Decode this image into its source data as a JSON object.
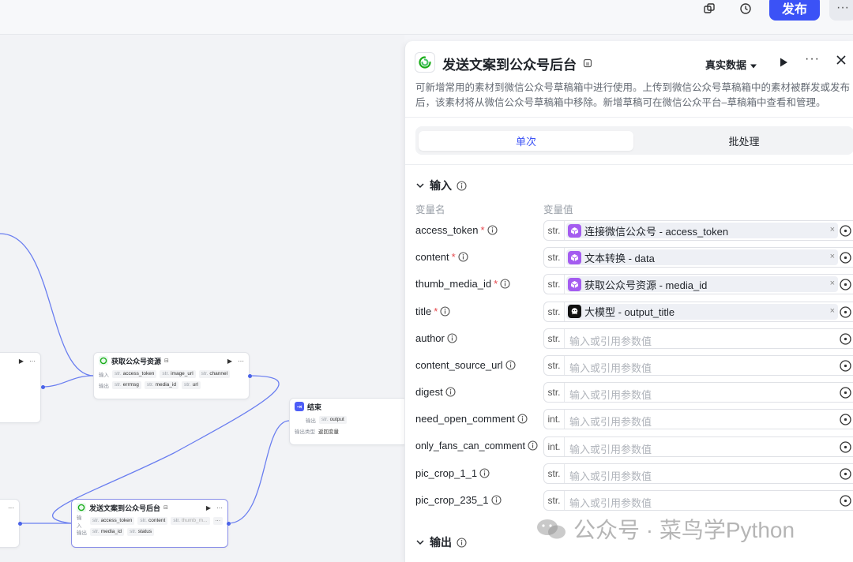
{
  "topbar": {
    "publish_label": "发布",
    "more_label": "···"
  },
  "canvas": {
    "node_fetch": {
      "title": "获取公众号资源",
      "in_label": "输入",
      "out_label": "输出",
      "inputs": [
        {
          "type": "str.",
          "name": "access_token"
        },
        {
          "type": "str.",
          "name": "image_url"
        },
        {
          "type": "str.",
          "name": "channel"
        }
      ],
      "outputs": [
        {
          "type": "str.",
          "name": "errmsg"
        },
        {
          "type": "str.",
          "name": "media_id"
        },
        {
          "type": "str.",
          "name": "url"
        }
      ]
    },
    "node_end": {
      "title": "结束",
      "out_label": "输出",
      "output": {
        "type": "str.",
        "name": "output"
      },
      "out_type_label": "输出类型",
      "out_type_value": "返回变量"
    },
    "node_send": {
      "title": "发送文案到公众号后台",
      "in_label": "输入",
      "out_label": "输出",
      "inputs": [
        {
          "type": "str.",
          "name": "access_token"
        },
        {
          "type": "str.",
          "name": "content"
        },
        {
          "type": "str.",
          "name": "thumb_m..."
        }
      ],
      "more": "···",
      "outputs": [
        {
          "type": "str.",
          "name": "media_id"
        },
        {
          "type": "str.",
          "name": "status"
        }
      ]
    }
  },
  "panel": {
    "title": "发送文案到公众号后台",
    "data_mode": "真实数据",
    "more": "···",
    "description": "可新增常用的素材到微信公众号草稿箱中进行使用。上传到微信公众号草稿箱中的素材被群发或发布后，该素材将从微信公众号草稿箱中移除。新增草稿可在微信公众平台–草稿箱中查看和管理。",
    "tabs": [
      "单次",
      "批处理"
    ],
    "input_section": "输入",
    "output_section": "输出",
    "col_name": "变量名",
    "col_value": "变量值",
    "params": [
      {
        "name": "access_token",
        "required": true,
        "type": "str.",
        "ref_icon": "purple",
        "ref_text": "连接微信公众号 - access_token"
      },
      {
        "name": "content",
        "required": true,
        "type": "str.",
        "ref_icon": "purple",
        "ref_text": "文本转换 - data"
      },
      {
        "name": "thumb_media_id",
        "required": true,
        "type": "str.",
        "ref_icon": "purple",
        "ref_text": "获取公众号资源 - media_id"
      },
      {
        "name": "title",
        "required": true,
        "type": "str.",
        "ref_icon": "black",
        "ref_text": "大模型 - output_title"
      },
      {
        "name": "author",
        "required": false,
        "type": "str.",
        "placeholder": "输入或引用参数值"
      },
      {
        "name": "content_source_url",
        "required": false,
        "type": "str.",
        "placeholder": "输入或引用参数值"
      },
      {
        "name": "digest",
        "required": false,
        "type": "str.",
        "placeholder": "输入或引用参数值"
      },
      {
        "name": "need_open_comment",
        "required": false,
        "type": "int.",
        "placeholder": "输入或引用参数值"
      },
      {
        "name": "only_fans_can_comment",
        "required": false,
        "type": "int.",
        "placeholder": "输入或引用参数值"
      },
      {
        "name": "pic_crop_1_1",
        "required": false,
        "type": "str.",
        "placeholder": "输入或引用参数值"
      },
      {
        "name": "pic_crop_235_1",
        "required": false,
        "type": "str.",
        "placeholder": "输入或引用参数值"
      }
    ]
  },
  "watermark": "公众号 · 菜鸟学Python",
  "colors": {
    "accent": "#3b52f6",
    "edge": "#4a63e8",
    "required": "#e5484d",
    "plugin": "#a45cf0",
    "wechat": "#1aad19"
  }
}
